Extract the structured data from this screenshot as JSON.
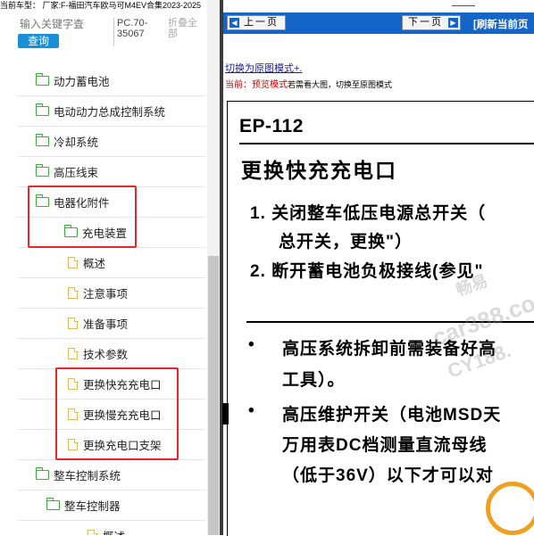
{
  "top_status": "当前车型： 厂家:F-福田汽车欧马可M4EV合集2023-2025",
  "search": {
    "keyword_placeholder": "输入关键字査",
    "query_button": "查询",
    "model_code": "PC.70-\n35067",
    "collapse_all": "折叠全\n部"
  },
  "tree": {
    "items": [
      {
        "label": "动力蓄电池",
        "icon": "folder-icon"
      },
      {
        "label": "电动动力总成控制系统",
        "icon": "folder-icon"
      },
      {
        "label": "冷却系统",
        "icon": "folder-icon"
      },
      {
        "label": "高压线束",
        "icon": "folder-icon"
      },
      {
        "label": "电器化附件",
        "icon": "folder-open-icon"
      },
      {
        "label": "充电装置",
        "icon": "folder-open-icon"
      },
      {
        "label": "概述",
        "icon": "document-icon"
      },
      {
        "label": "注意事项",
        "icon": "document-icon"
      },
      {
        "label": "准备事项",
        "icon": "document-icon"
      },
      {
        "label": "技术参数",
        "icon": "document-icon"
      },
      {
        "label": "更换快充充电口",
        "icon": "document-icon"
      },
      {
        "label": "更换慢充充电口",
        "icon": "document-icon"
      },
      {
        "label": "更换充电口支架",
        "icon": "document-icon"
      },
      {
        "label": "整车控制系统",
        "icon": "folder-open-icon"
      },
      {
        "label": "整车控制器",
        "icon": "folder-open-icon"
      },
      {
        "label": "概述",
        "icon": "document-icon"
      }
    ]
  },
  "nav": {
    "prev_label": "上一页",
    "next_label": "下一页",
    "refresh_label": "[刷新当前页"
  },
  "links": {
    "switch_original": "切换为原图模式+.",
    "current_label": "当前：",
    "preview_mode": "预览模式",
    "hint": "若需看大图，切换至原图模式"
  },
  "document": {
    "code": "EP-112",
    "title": "更换快充充电口",
    "step1_line1": "1. 关闭整车低压电源总开关（",
    "step1_line2": "总开关，更换\"）",
    "step2": "2. 断开蓄电池负极接线(参见\"",
    "bullet1_line1": "高压系统拆卸前需装备好高",
    "bullet1_line2": "工具）。",
    "bullet2_line1": "高压维护开关（电池MSD天",
    "bullet2_line2": "万用表DC档测量直流母线",
    "bullet2_line3": "（低于36V）以下才可以对",
    "bullet_char": "•"
  },
  "watermark": {
    "line1": "畅易",
    "line2": "car388.co",
    "line3": "CY188."
  },
  "colors": {
    "accent_blue": "#1565c8",
    "highlight_red": "#e8262a",
    "folder_green": "#3cae3c",
    "doc_orange": "#e8b860"
  }
}
